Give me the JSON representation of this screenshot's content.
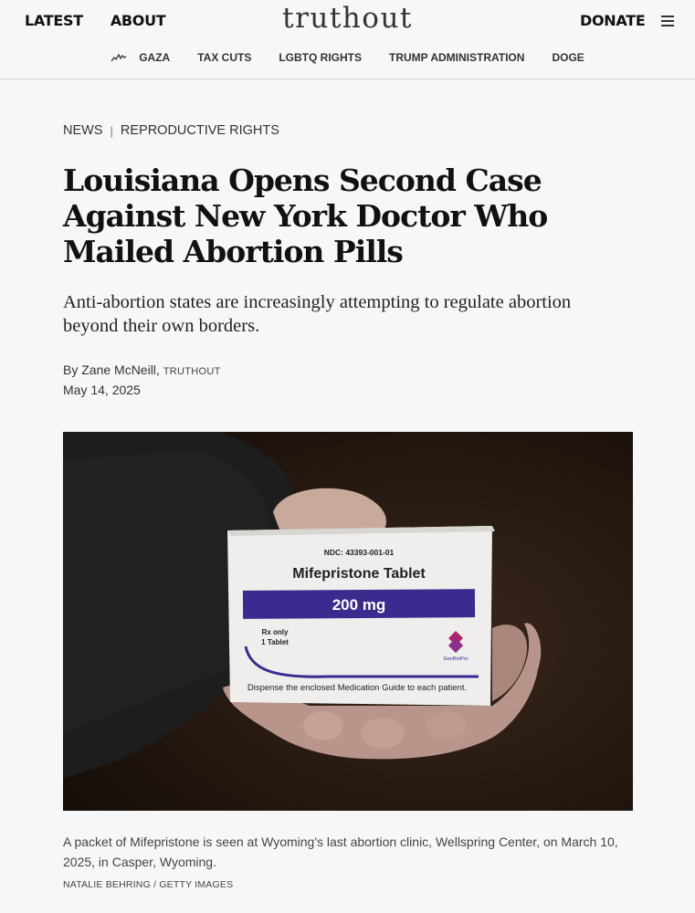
{
  "header": {
    "nav_left": [
      "LATEST",
      "ABOUT"
    ],
    "logo": "truthout",
    "donate": "DONATE",
    "menu_icon": "hamburger-menu-icon",
    "trending_icon": "trending-icon",
    "topics": [
      "GAZA",
      "TAX CUTS",
      "LGBTQ RIGHTS",
      "TRUMP ADMINISTRATION",
      "DOGE"
    ]
  },
  "article": {
    "breadcrumb": {
      "section": "NEWS",
      "separator": "|",
      "category": "REPRODUCTIVE RIGHTS"
    },
    "title": "Louisiana Opens Second Case Against New York Doctor Who Mailed Abortion Pills",
    "dek": "Anti-abortion states are increasingly attempting to regulate abortion beyond their own borders.",
    "byline_prefix": "By Zane McNeill,",
    "byline_outlet": "TRUTHOUT",
    "date": "May 14, 2025"
  },
  "image": {
    "box_text": {
      "ndc": "NDC: 43393-001-01",
      "name": "Mifepristone Tablet",
      "dose": "200 mg",
      "rx_only": "Rx only",
      "count": "1 Tablet",
      "brand": "GenBioPro",
      "guide": "Dispense the enclosed Medication Guide to each patient."
    },
    "caption": "A packet of Mifepristone is seen at Wyoming's last abortion clinic, Wellspring Center, on March 10, 2025, in Casper, Wyoming.",
    "credit": "NATALIE BEHRING / GETTY IMAGES"
  },
  "colors": {
    "background": "#f7f7f7",
    "text": "#111111",
    "box_purple": "#3c2a8f",
    "photo_dark": "#1b130d"
  }
}
